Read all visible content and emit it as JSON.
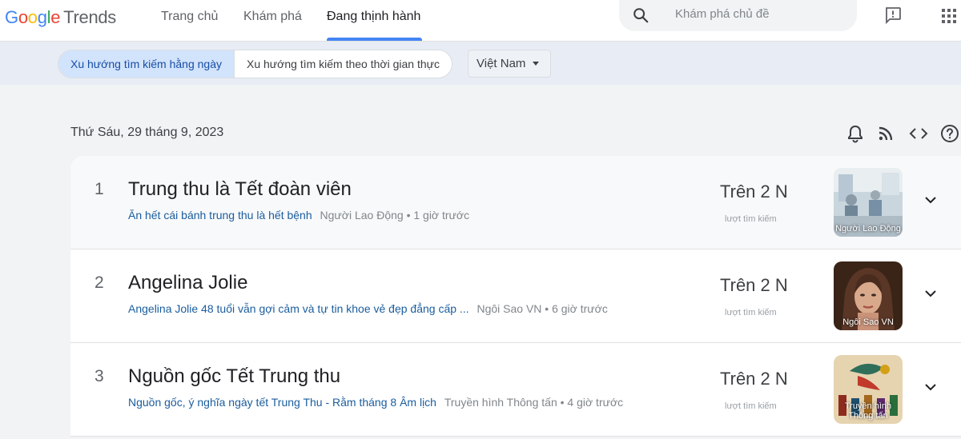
{
  "header": {
    "logo_google": [
      "G",
      "o",
      "o",
      "g",
      "l",
      "e"
    ],
    "logo_trends": "Trends",
    "nav": [
      "Trang chủ",
      "Khám phá",
      "Đang thịnh hành"
    ],
    "active_nav": "Đang thịnh hành",
    "search_placeholder": "Khám phá chủ đề",
    "icons": [
      "search-icon",
      "feedback-icon",
      "apps-icon"
    ]
  },
  "subbar": {
    "tabs": [
      "Xu hướng tìm kiếm hằng ngày",
      "Xu hướng tìm kiếm theo thời gian thực"
    ],
    "active_tab": "Xu hướng tìm kiếm hằng ngày",
    "country": "Việt Nam"
  },
  "date": "Thứ Sáu, 29 tháng 9, 2023",
  "tools": [
    "bell-icon",
    "rss-icon",
    "embed-icon",
    "help-icon"
  ],
  "trends": [
    {
      "rank": "1",
      "title": "Trung thu là Tết đoàn viên",
      "article": "Ăn hết cái bánh trung thu là hết bệnh",
      "source": "Người Lao Động • 1 giờ trước",
      "count": "Trên 2 N",
      "count_label": "lượt tìm kiếm",
      "thumb_caption": "Người Lao Động"
    },
    {
      "rank": "2",
      "title": "Angelina Jolie",
      "article": "Angelina Jolie 48 tuổi vẫn gợi cảm và tự tin khoe vẻ đẹp đẳng cấp ...",
      "source": "Ngôi Sao VN • 6 giờ trước",
      "count": "Trên 2 N",
      "count_label": "lượt tìm kiếm",
      "thumb_caption": "Ngôi Sao VN"
    },
    {
      "rank": "3",
      "title": "Nguồn gốc Tết Trung thu",
      "article": "Nguồn gốc, ý nghĩa ngày tết Trung Thu - Rằm tháng 8 Âm lịch",
      "source": "Truyền hình Thông tấn • 4 giờ trước",
      "count": "Trên 2 N",
      "count_label": "lượt tìm kiếm",
      "thumb_caption": "Truyền hình Thông tấn"
    }
  ],
  "colors": {
    "accent": "#4285f4",
    "link": "#1a5d9e",
    "active_tab_bg": "#d2e3fc"
  }
}
